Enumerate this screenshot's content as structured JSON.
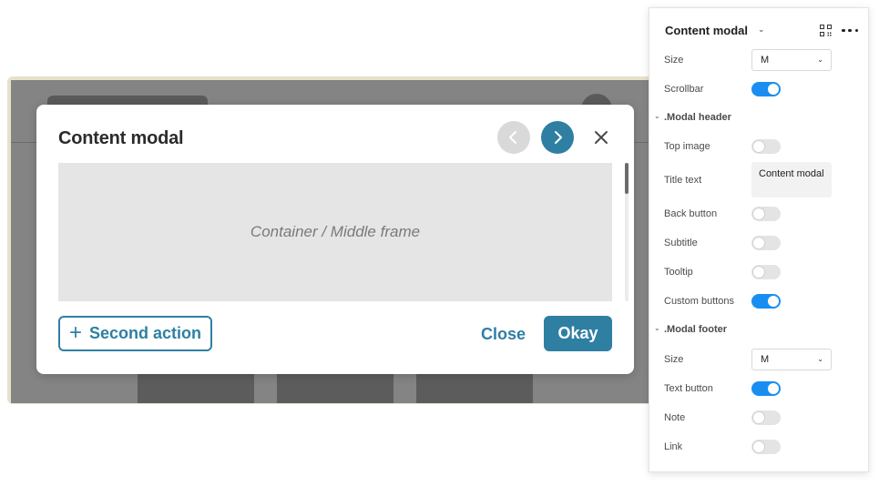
{
  "modal": {
    "title": "Content modal",
    "middle_frame_label": "Container / Middle frame",
    "second_action_label": "Second action",
    "close_label": "Close",
    "okay_label": "Okay",
    "icons": {
      "back": "chevron-left-icon",
      "next": "chevron-right-icon",
      "close": "close-icon",
      "add": "plus-icon"
    }
  },
  "panel": {
    "title": "Content modal",
    "rows": {
      "size": {
        "label": "Size",
        "value": "M"
      },
      "scrollbar": {
        "label": "Scrollbar",
        "on": true
      }
    },
    "modal_header": {
      "section_label": ".Modal header",
      "top_image": {
        "label": "Top image",
        "on": false
      },
      "title_text": {
        "label": "Title text",
        "value": "Content modal"
      },
      "back_button": {
        "label": "Back button",
        "on": false
      },
      "subtitle": {
        "label": "Subtitle",
        "on": false
      },
      "tooltip": {
        "label": "Tooltip",
        "on": false
      },
      "custom_buttons": {
        "label": "Custom buttons",
        "on": true
      }
    },
    "modal_footer": {
      "section_label": ".Modal footer",
      "size": {
        "label": "Size",
        "value": "M"
      },
      "text_button": {
        "label": "Text button",
        "on": true
      },
      "note": {
        "label": "Note",
        "on": false
      },
      "link": {
        "label": "Link",
        "on": false
      }
    }
  },
  "colors": {
    "accent": "#2f7fa3",
    "toggle_on": "#1a8ef0",
    "toggle_off": "#e4e4e4",
    "canvas_overlay": "#848484",
    "canvas_frame": "#e7e1ca"
  }
}
